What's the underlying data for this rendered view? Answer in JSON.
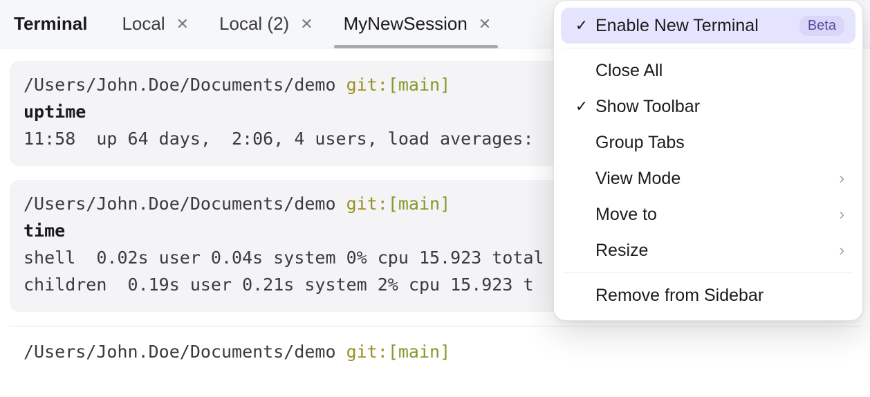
{
  "tabbar": {
    "title": "Terminal",
    "tabs": [
      {
        "label": "Local",
        "active": false
      },
      {
        "label": "Local (2)",
        "active": false
      },
      {
        "label": "MyNewSession",
        "active": true
      }
    ]
  },
  "prompt": {
    "path": "/Users/John.Doe/Documents/demo",
    "git_label": "git:",
    "git_branch": "[main]"
  },
  "blocks": [
    {
      "command": "uptime",
      "output": "11:58  up 64 days,  2:06, 4 users, load averages:"
    },
    {
      "command": "time",
      "output": "shell  0.02s user 0.04s system 0% cpu 15.923 total\nchildren  0.19s user 0.21s system 2% cpu 15.923 t"
    }
  ],
  "menu": {
    "items": [
      {
        "label": "Enable New Terminal",
        "checked": true,
        "badge": "Beta",
        "highlight": true
      },
      {
        "sep": true
      },
      {
        "label": "Close All"
      },
      {
        "label": "Show Toolbar",
        "checked": true
      },
      {
        "label": "Group Tabs"
      },
      {
        "label": "View Mode",
        "submenu": true
      },
      {
        "label": "Move to",
        "submenu": true
      },
      {
        "label": "Resize",
        "submenu": true
      },
      {
        "sep": true
      },
      {
        "label": "Remove from Sidebar"
      }
    ]
  }
}
